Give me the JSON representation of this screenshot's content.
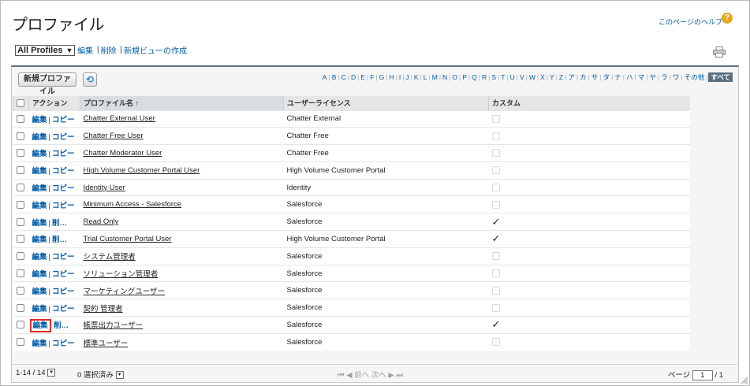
{
  "header": {
    "title": "プロファイル",
    "help_label": "このページのヘルプ",
    "help_icon": "?"
  },
  "viewbar": {
    "selected_view": "All Profiles",
    "edit": "編集",
    "delete": "削除",
    "new_view": "新規ビューの作成"
  },
  "toolbar": {
    "new_button": "新規プロファイル",
    "refresh_icon": "⟲"
  },
  "alphabet": [
    "A",
    "B",
    "C",
    "D",
    "E",
    "F",
    "G",
    "H",
    "I",
    "J",
    "K",
    "L",
    "M",
    "N",
    "O",
    "P",
    "Q",
    "R",
    "S",
    "T",
    "U",
    "V",
    "W",
    "X",
    "Y",
    "Z",
    "ア",
    "カ",
    "サ",
    "タ",
    "ナ",
    "ハ",
    "マ",
    "ヤ",
    "ラ",
    "ワ",
    "その他",
    "すべて"
  ],
  "alphabet_active": "すべて",
  "columns": {
    "action": "アクション",
    "name": "プロファイル名",
    "sort_indicator": "↑",
    "license": "ユーザーライセンス",
    "custom": "カスタム"
  },
  "rows": [
    {
      "edit": "編集",
      "op": "コピー",
      "name": "Chatter External User",
      "license": "Chatter External",
      "custom": false
    },
    {
      "edit": "編集",
      "op": "コピー",
      "name": "Chatter Free User",
      "license": "Chatter Free",
      "custom": false
    },
    {
      "edit": "編集",
      "op": "コピー",
      "name": "Chatter Moderator User",
      "license": "Chatter Free",
      "custom": false
    },
    {
      "edit": "編集",
      "op": "コピー",
      "name": "High Volume Customer Portal User",
      "license": "High Volume Customer Portal",
      "custom": false
    },
    {
      "edit": "編集",
      "op": "コピー",
      "name": "Identity User",
      "license": "Identity",
      "custom": false
    },
    {
      "edit": "編集",
      "op": "コピー",
      "name": "Minimum Access - Salesforce",
      "license": "Salesforce",
      "custom": false
    },
    {
      "edit": "編集",
      "op": "削…",
      "name": "Read Only",
      "license": "Salesforce",
      "custom": true
    },
    {
      "edit": "編集",
      "op": "削…",
      "name": "Trial Customer Portal User",
      "license": "High Volume Customer Portal",
      "custom": true
    },
    {
      "edit": "編集",
      "op": "コピー",
      "name": "システム管理者",
      "license": "Salesforce",
      "custom": false
    },
    {
      "edit": "編集",
      "op": "コピー",
      "name": "ソリューション管理者",
      "license": "Salesforce",
      "custom": false
    },
    {
      "edit": "編集",
      "op": "コピー",
      "name": "マーケティングユーザー",
      "license": "Salesforce",
      "custom": false
    },
    {
      "edit": "編集",
      "op": "コピー",
      "name": "契約 管理者",
      "license": "Salesforce",
      "custom": false
    },
    {
      "edit": "編集",
      "op": "削…",
      "name": "帳票出力ユーザー",
      "license": "Salesforce",
      "custom": true
    },
    {
      "edit": "編集",
      "op": "コピー",
      "name": "標準ユーザー",
      "license": "Salesforce",
      "custom": false
    }
  ],
  "footer": {
    "range": "1-14 / 14",
    "selected": "0 選択済み",
    "first_icon": "⏮",
    "prev": "◀ 前へ",
    "next": "次へ ▶",
    "last_icon": "⏭",
    "page_label": "ページ",
    "page_value": "1",
    "page_total": "/ 1"
  },
  "accent_color": "#015ba7",
  "highlight_color": "#e02b2b"
}
